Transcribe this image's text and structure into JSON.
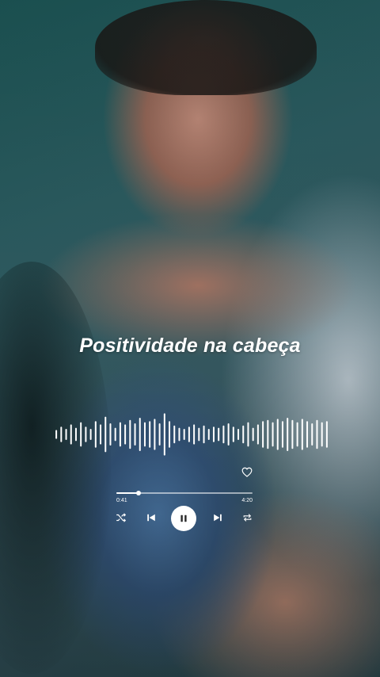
{
  "player": {
    "song_title": "Positividade na cabeça",
    "time_elapsed": "0:41",
    "time_total": "4:20",
    "progress": 0.16,
    "state": "playing",
    "waveform_levels": [
      0.2,
      0.35,
      0.25,
      0.45,
      0.3,
      0.55,
      0.35,
      0.25,
      0.6,
      0.45,
      0.8,
      0.5,
      0.3,
      0.55,
      0.45,
      0.65,
      0.5,
      0.75,
      0.55,
      0.6,
      0.7,
      0.5,
      0.95,
      0.6,
      0.4,
      0.3,
      0.25,
      0.35,
      0.45,
      0.3,
      0.4,
      0.25,
      0.35,
      0.3,
      0.4,
      0.5,
      0.35,
      0.25,
      0.4,
      0.55,
      0.3,
      0.45,
      0.6,
      0.65,
      0.55,
      0.7,
      0.6,
      0.75,
      0.65,
      0.55,
      0.7,
      0.6,
      0.5,
      0.65,
      0.55,
      0.6
    ],
    "accent_color": "#ffffff"
  },
  "icons": {
    "like": "heart-icon",
    "shuffle": "shuffle-icon",
    "previous": "skip-previous-icon",
    "play_pause": "pause-icon",
    "next": "skip-next-icon",
    "repeat": "repeat-icon"
  }
}
